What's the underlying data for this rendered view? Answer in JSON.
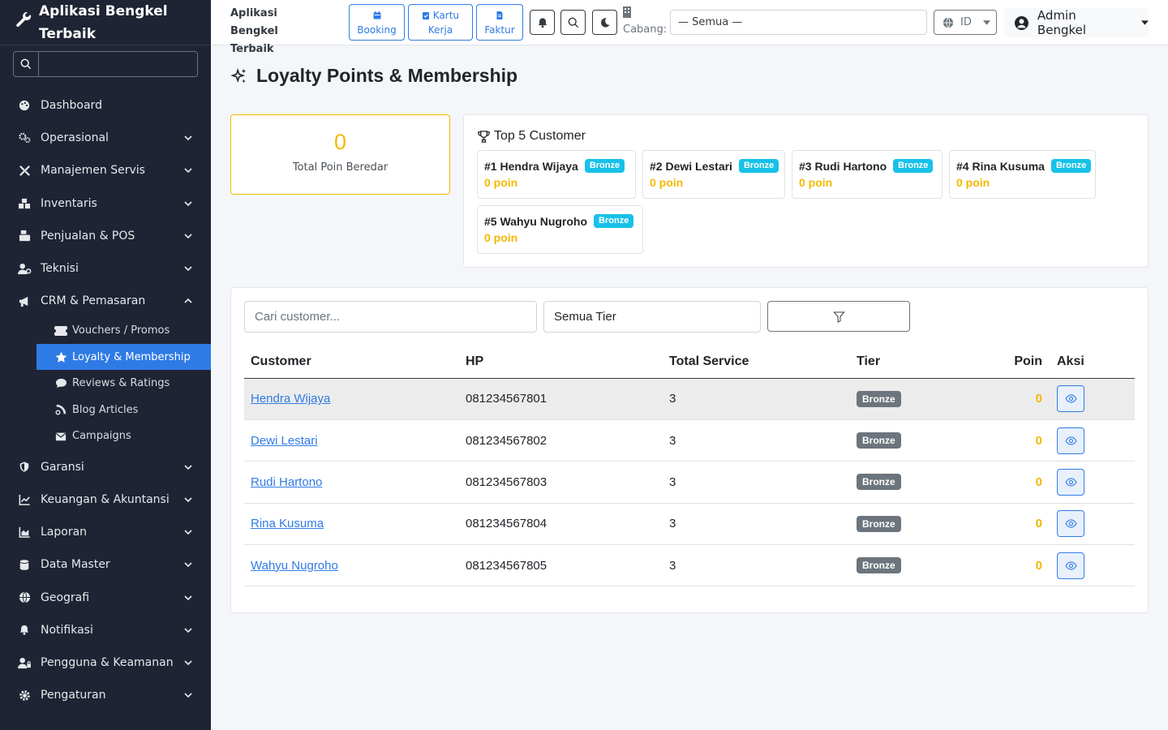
{
  "app": {
    "title": "Aplikasi Bengkel Terbaik"
  },
  "sidebar": {
    "brand_line1": "Aplikasi Bengkel",
    "brand_line2": "Terbaik",
    "search_placeholder": "",
    "items": [
      {
        "label": "Dashboard",
        "icon": "palette-icon",
        "expandable": false
      },
      {
        "label": "Operasional",
        "icon": "gears-icon",
        "expandable": true
      },
      {
        "label": "Manajemen Servis",
        "icon": "tools-icon",
        "expandable": true
      },
      {
        "label": "Inventaris",
        "icon": "boxes-icon",
        "expandable": true
      },
      {
        "label": "Penjualan & POS",
        "icon": "cash-register-icon",
        "expandable": true
      },
      {
        "label": "Teknisi",
        "icon": "user-gear-icon",
        "expandable": true
      },
      {
        "label": "CRM & Pemasaran",
        "icon": "bullhorn-icon",
        "expandable": true,
        "open": true
      },
      {
        "label": "Garansi",
        "icon": "shield-icon",
        "expandable": true
      },
      {
        "label": "Keuangan & Akuntansi",
        "icon": "chart-line-icon",
        "expandable": true
      },
      {
        "label": "Laporan",
        "icon": "chart-area-icon",
        "expandable": true
      },
      {
        "label": "Data Master",
        "icon": "database-icon",
        "expandable": true
      },
      {
        "label": "Geografi",
        "icon": "globe-icon",
        "expandable": true
      },
      {
        "label": "Notifikasi",
        "icon": "bell-icon",
        "expandable": true
      },
      {
        "label": "Pengguna & Keamanan",
        "icon": "user-lock-icon",
        "expandable": true
      },
      {
        "label": "Pengaturan",
        "icon": "cog-icon",
        "expandable": true
      }
    ],
    "crm_sub": [
      {
        "label": "Vouchers / Promos",
        "icon": "ticket-icon"
      },
      {
        "label": "Loyalty & Membership",
        "icon": "star-icon",
        "active": true
      },
      {
        "label": "Reviews & Ratings",
        "icon": "comment-icon"
      },
      {
        "label": "Blog Articles",
        "icon": "blog-icon"
      },
      {
        "label": "Campaigns",
        "icon": "envelope-icon"
      }
    ]
  },
  "topbar": {
    "brand_line1": "Aplikasi Bengkel",
    "brand_line2": "Terbaik",
    "booking": "Booking",
    "kartu_line1": "Kartu",
    "kartu_line2": "Kerja",
    "faktur": "Faktur",
    "cabang_label": "Cabang:",
    "cabang_value": "— Semua —",
    "lang": "ID",
    "user": "Admin Bengkel"
  },
  "page": {
    "title": "Loyalty Points & Membership",
    "stat_value": "0",
    "stat_label": "Total Poin Beredar",
    "top5_title": "Top 5 Customer",
    "top5": [
      {
        "name": "#1 Hendra Wijaya",
        "tier": "Bronze",
        "points": "0 poin"
      },
      {
        "name": "#2 Dewi Lestari",
        "tier": "Bronze",
        "points": "0 poin"
      },
      {
        "name": "#3 Rudi Hartono",
        "tier": "Bronze",
        "points": "0 poin"
      },
      {
        "name": "#4 Rina Kusuma",
        "tier": "Bronze",
        "points": "0 poin"
      },
      {
        "name": "#5 Wahyu Nugroho",
        "tier": "Bronze",
        "points": "0 poin"
      }
    ],
    "search_placeholder": "Cari customer...",
    "tier_filter": "Semua Tier",
    "columns": [
      "Customer",
      "HP",
      "Total Service",
      "Tier",
      "Poin",
      "Aksi"
    ],
    "rows": [
      {
        "customer": "Hendra Wijaya",
        "hp": "081234567801",
        "service": "3",
        "tier": "Bronze",
        "poin": "0"
      },
      {
        "customer": "Dewi Lestari",
        "hp": "081234567802",
        "service": "3",
        "tier": "Bronze",
        "poin": "0"
      },
      {
        "customer": "Rudi Hartono",
        "hp": "081234567803",
        "service": "3",
        "tier": "Bronze",
        "poin": "0"
      },
      {
        "customer": "Rina Kusuma",
        "hp": "081234567804",
        "service": "3",
        "tier": "Bronze",
        "poin": "0"
      },
      {
        "customer": "Wahyu Nugroho",
        "hp": "081234567805",
        "service": "3",
        "tier": "Bronze",
        "poin": "0"
      }
    ]
  },
  "colors": {
    "accent": "#2f7be5",
    "warning": "#f5b800",
    "info": "#17c1e8",
    "sidebar": "#1e2433"
  }
}
